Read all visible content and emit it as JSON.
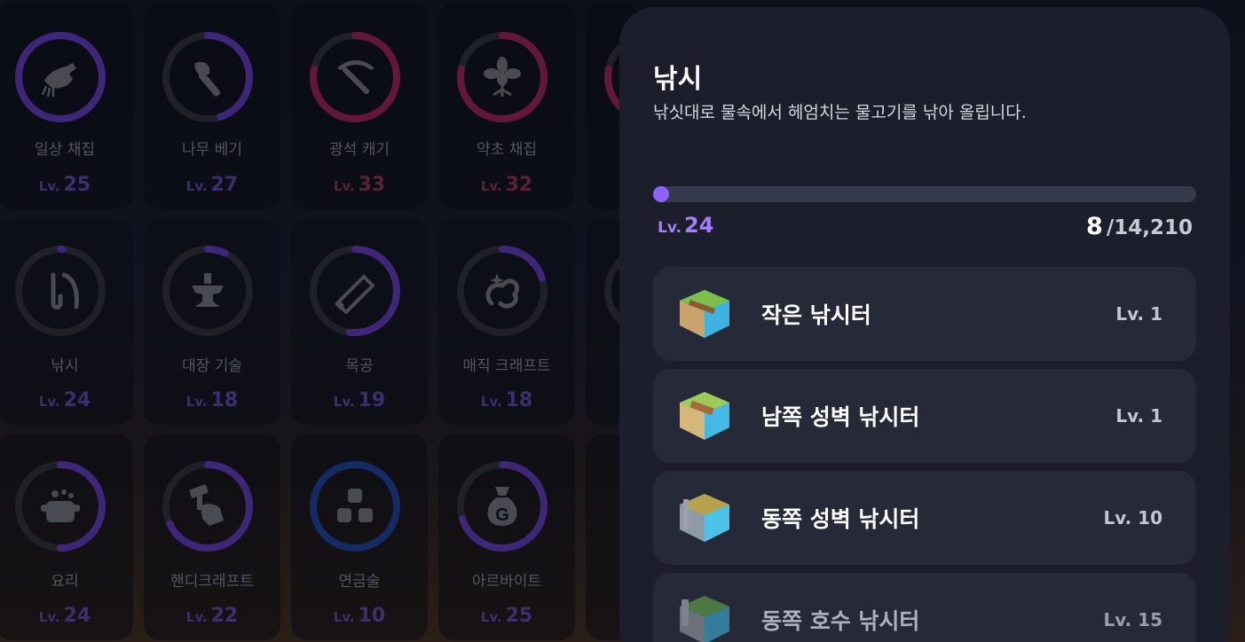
{
  "skills": [
    {
      "name": "일상 채집",
      "lv": "Lv.",
      "level": "25",
      "ring_color": "#3e2778",
      "progress": 1.0,
      "icon": "hand-gather-icon"
    },
    {
      "name": "나무 베기",
      "lv": "Lv.",
      "level": "27",
      "ring_color": "#3e2778",
      "progress": 0.45,
      "icon": "axe-icon"
    },
    {
      "name": "광석 캐기",
      "lv": "Lv.",
      "level": "33",
      "ring_color": "#64163b",
      "progress": 0.78,
      "icon": "pickaxe-icon"
    },
    {
      "name": "약초 채집",
      "lv": "Lv.",
      "level": "32",
      "ring_color": "#64163b",
      "progress": 0.78,
      "icon": "herb-icon"
    },
    {
      "name": "낚시",
      "lv": "Lv.",
      "level": "24",
      "ring_color": "#3e2778",
      "progress": 0.01,
      "icon": "fishing-icon"
    },
    {
      "name": "대장 기술",
      "lv": "Lv.",
      "level": "18",
      "ring_color": "#3e2778",
      "progress": 0.07,
      "icon": "anvil-icon"
    },
    {
      "name": "목공",
      "lv": "Lv.",
      "level": "19",
      "ring_color": "#3e2778",
      "progress": 0.52,
      "icon": "saw-icon"
    },
    {
      "name": "매직 크래프트",
      "lv": "Lv.",
      "level": "18",
      "ring_color": "#3e2778",
      "progress": 0.2,
      "icon": "magic-craft-icon"
    },
    {
      "name": "요리",
      "lv": "Lv.",
      "level": "24",
      "ring_color": "#3e2778",
      "progress": 0.5,
      "icon": "cooking-pot-icon"
    },
    {
      "name": "핸디크래프트",
      "lv": "Lv.",
      "level": "22",
      "ring_color": "#3e2778",
      "progress": 0.68,
      "icon": "hammer-hand-icon"
    },
    {
      "name": "연금술",
      "lv": "Lv.",
      "level": "10",
      "ring_color": "#132c63",
      "progress": 1.0,
      "icon": "alchemy-icon"
    },
    {
      "name": "아르바이트",
      "lv": "Lv.",
      "level": "25",
      "ring_color": "#3e2778",
      "progress": 0.7,
      "icon": "money-bag-icon"
    }
  ],
  "detail": {
    "title": "낚시",
    "description": "낚싯대로 물속에서 헤엄치는 물고기를 낚아 올립니다.",
    "level_prefix": "Lv.",
    "level": "24",
    "xp_current": "8",
    "xp_max": "/14,210",
    "xp_progress": 0.0006,
    "accent_color": "#8d63ff"
  },
  "fishing_spots": [
    {
      "name": "작은 낚시터",
      "level": "Lv. 1"
    },
    {
      "name": "남쪽 성벽 낚시터",
      "level": "Lv. 1"
    },
    {
      "name": "동쪽 성벽 낚시터",
      "level": "Lv. 10"
    },
    {
      "name": "동쪽 호수 낚시터",
      "level": "Lv. 15"
    }
  ]
}
